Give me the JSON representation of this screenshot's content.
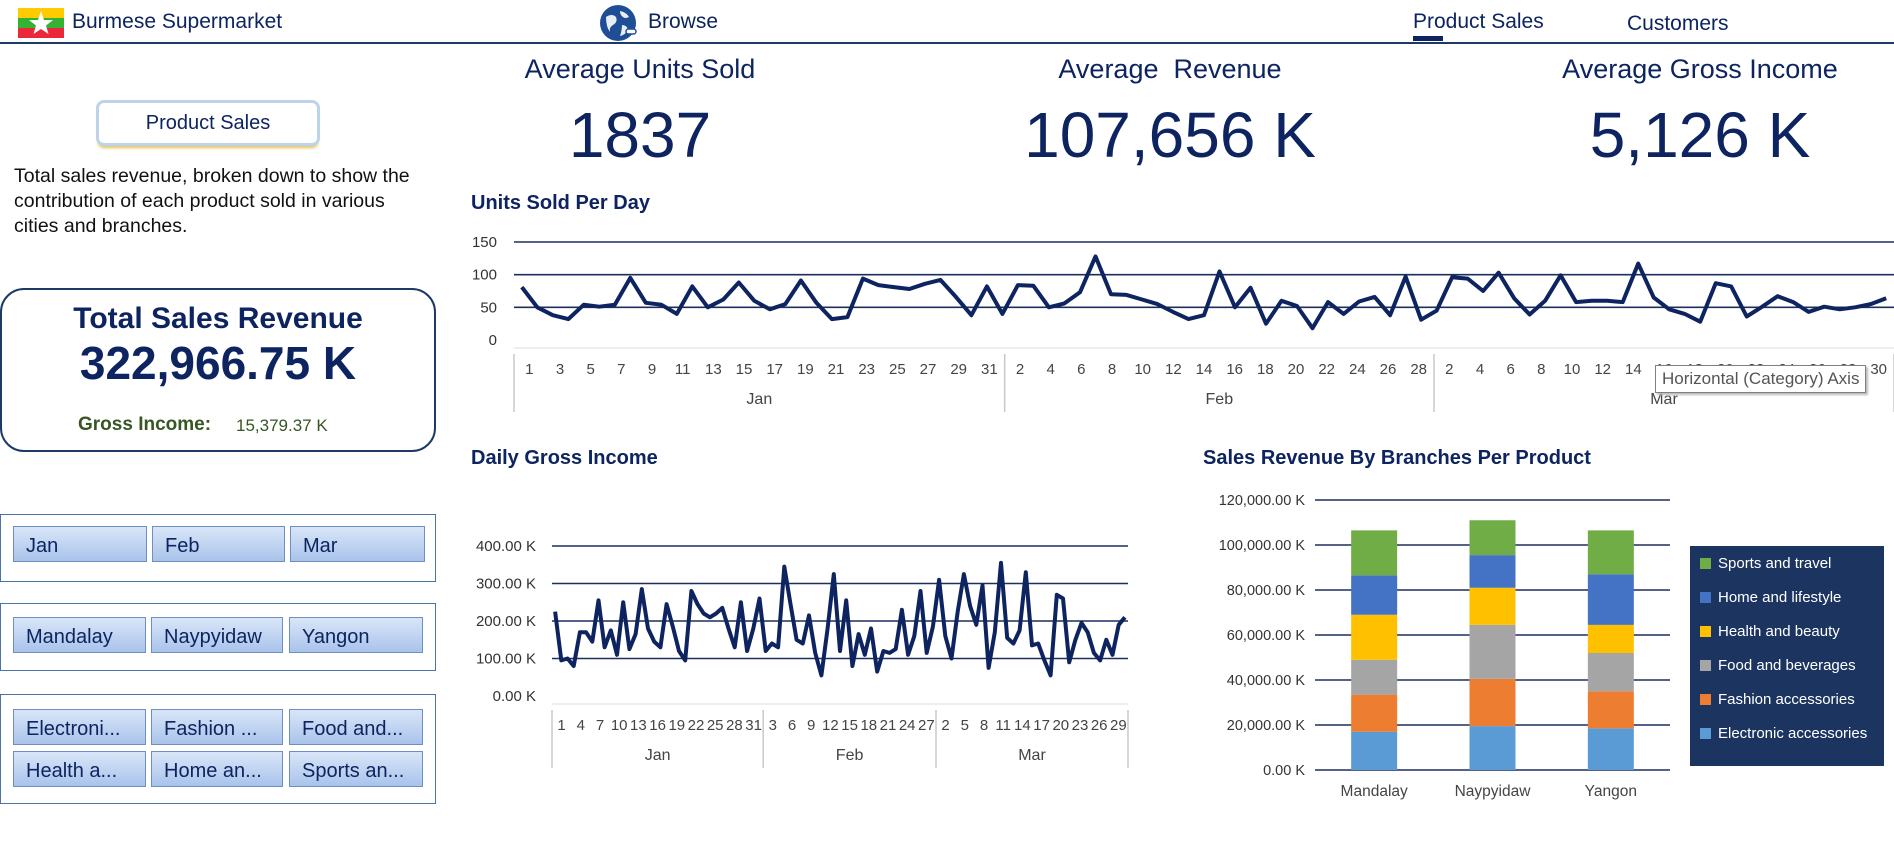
{
  "header": {
    "brand": "Burmese Supermarket",
    "browse": "Browse",
    "nav": [
      {
        "label": "Product Sales",
        "active": true
      },
      {
        "label": "Customers",
        "active": false
      }
    ]
  },
  "left": {
    "section_button": "Product Sales",
    "description": "Total sales revenue, broken down to show the contribution of each product sold in various cities and branches.",
    "total_title": "Total Sales Revenue",
    "total_value": "322,966.75 K",
    "gross_label": "Gross Income:",
    "gross_value": "15,379.37 K",
    "months": [
      "Jan",
      "Feb",
      "Mar"
    ],
    "cities": [
      "Mandalay",
      "Naypyidaw",
      "Yangon"
    ],
    "products": [
      "Electroni...",
      "Fashion ...",
      "Food and...",
      "Health a...",
      "Home an...",
      "Sports an..."
    ]
  },
  "kpis": [
    {
      "title": "Average Units Sold",
      "value": "1837"
    },
    {
      "title": "Average  Revenue",
      "value": "107,656 K"
    },
    {
      "title": "Average Gross Income",
      "value": "5,126 K"
    }
  ],
  "tooltip": "Horizontal (Category) Axis",
  "chart_data": [
    {
      "type": "line",
      "title": "Units Sold Per Day",
      "ylim": [
        0,
        150
      ],
      "yticks": [
        "0",
        "50",
        "100",
        "150"
      ],
      "groups": [
        "Jan",
        "Feb",
        "Mar"
      ],
      "day_labels": {
        "Jan": [
          "1",
          "3",
          "5",
          "7",
          "9",
          "11",
          "13",
          "15",
          "17",
          "19",
          "21",
          "23",
          "25",
          "27",
          "29",
          "31"
        ],
        "Feb": [
          "2",
          "4",
          "6",
          "8",
          "10",
          "12",
          "14",
          "16",
          "18",
          "20",
          "22",
          "24",
          "26",
          "28"
        ],
        "Mar": [
          "2",
          "4",
          "6",
          "8",
          "10",
          "12",
          "14",
          "16",
          "18",
          "20",
          "22",
          "24",
          "26",
          "28",
          "30"
        ]
      },
      "color": "#0d2460",
      "values": [
        81,
        50,
        38,
        32,
        54,
        51,
        54,
        95,
        57,
        54,
        40,
        82,
        50,
        62,
        88,
        60,
        47,
        55,
        91,
        57,
        32,
        35,
        94,
        84,
        81,
        78,
        86,
        92,
        66,
        38,
        82,
        40,
        84,
        83,
        50,
        56,
        73,
        128,
        70,
        69,
        62,
        55,
        43,
        32,
        38,
        105,
        50,
        80,
        25,
        60,
        52,
        18,
        58,
        40,
        59,
        66,
        38,
        97,
        31,
        45,
        96,
        94,
        75,
        103,
        64,
        39,
        60,
        99,
        58,
        60,
        60,
        58,
        117,
        65,
        47,
        40,
        28,
        87,
        82,
        36,
        51,
        67,
        58,
        43,
        51,
        47,
        50,
        55,
        64
      ]
    },
    {
      "type": "line",
      "title": "Daily Gross Income",
      "ylim": [
        0,
        400
      ],
      "yticks": [
        "0.00 K",
        "100.00 K",
        "200.00 K",
        "300.00 K",
        "400.00 K"
      ],
      "groups": [
        "Jan",
        "Feb",
        "Mar"
      ],
      "day_labels": {
        "Jan": [
          "1",
          "4",
          "7",
          "10",
          "13",
          "16",
          "19",
          "22",
          "25",
          "28",
          "31"
        ],
        "Feb": [
          "3",
          "6",
          "9",
          "12",
          "15",
          "18",
          "21",
          "24",
          "27"
        ],
        "Mar": [
          "2",
          "5",
          "8",
          "11",
          "14",
          "17",
          "20",
          "23",
          "26",
          "29"
        ]
      },
      "color": "#0d2460",
      "values": [
        225,
        95,
        100,
        80,
        170,
        170,
        145,
        255,
        130,
        175,
        110,
        250,
        125,
        165,
        285,
        180,
        145,
        130,
        245,
        185,
        120,
        95,
        280,
        245,
        220,
        210,
        220,
        235,
        180,
        130,
        250,
        120,
        180,
        260,
        120,
        140,
        130,
        345,
        245,
        150,
        140,
        215,
        115,
        55,
        180,
        325,
        120,
        255,
        80,
        165,
        110,
        180,
        65,
        120,
        115,
        125,
        230,
        110,
        160,
        280,
        115,
        185,
        310,
        160,
        100,
        225,
        325,
        240,
        190,
        295,
        75,
        170,
        355,
        155,
        140,
        175,
        330,
        135,
        140,
        95,
        55,
        270,
        260,
        90,
        150,
        195,
        170,
        115,
        95,
        150,
        110,
        190,
        210
      ]
    },
    {
      "type": "bar",
      "stacked": true,
      "title": "Sales Revenue By Branches Per Product",
      "categories": [
        "Mandalay",
        "Naypyidaw",
        "Yangon"
      ],
      "ylim": [
        0,
        120000
      ],
      "yticks": [
        "0.00 K",
        "20,000.00 K",
        "40,000.00 K",
        "60,000.00 K",
        "80,000.00 K",
        "100,000.00 K",
        "120,000.00 K"
      ],
      "legend_position": "right",
      "series": [
        {
          "name": "Electronic accessories",
          "color": "#5b9bd5",
          "values": [
            17000,
            19500,
            18500
          ]
        },
        {
          "name": "Fashion accessories",
          "color": "#ed7d31",
          "values": [
            16500,
            21000,
            16500
          ]
        },
        {
          "name": "Food and beverages",
          "color": "#a5a5a5",
          "values": [
            15500,
            24000,
            17000
          ]
        },
        {
          "name": "Health and beauty",
          "color": "#ffc000",
          "values": [
            20000,
            16500,
            12500
          ]
        },
        {
          "name": "Home and lifestyle",
          "color": "#4472c4",
          "values": [
            17500,
            14500,
            22500
          ]
        },
        {
          "name": "Sports and travel",
          "color": "#70ad47",
          "values": [
            20000,
            15500,
            19500
          ]
        }
      ]
    }
  ]
}
